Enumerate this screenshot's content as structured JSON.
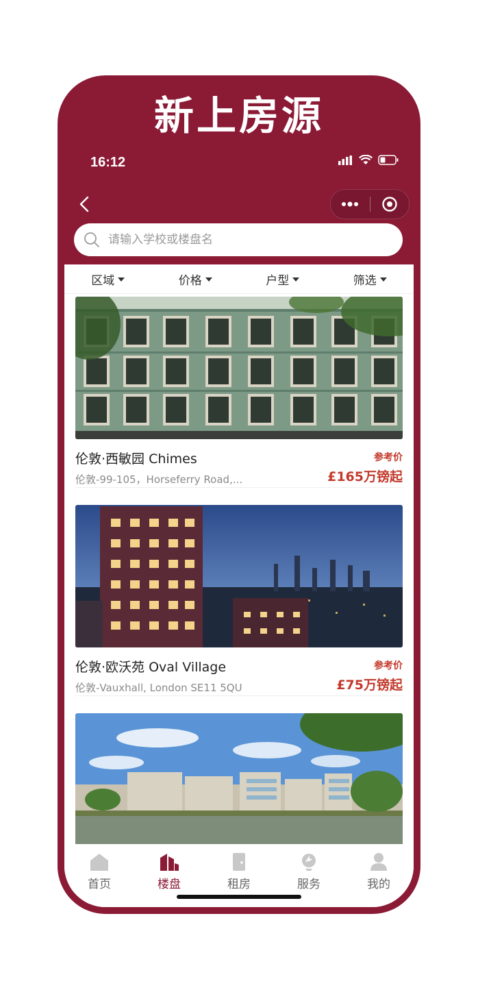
{
  "banner": {
    "headline": "新上房源"
  },
  "status_bar": {
    "time": "16:12"
  },
  "search": {
    "placeholder": "请输入学校或楼盘名"
  },
  "filters": [
    {
      "label": "区域"
    },
    {
      "label": "价格"
    },
    {
      "label": "户型"
    },
    {
      "label": "筛选"
    }
  ],
  "listings": [
    {
      "name": "伦敦·西敏园 Chimes",
      "address": "伦敦-99-105，Horseferry Road,...",
      "price_label": "参考价",
      "price": "£165万镑起"
    },
    {
      "name": "伦敦·欧沃苑 Oval Village",
      "address": "伦敦-Vauxhall, London SE11 5QU",
      "price_label": "参考价",
      "price": "£75万镑起"
    }
  ],
  "tabs": [
    {
      "label": "首页",
      "icon": "home-icon"
    },
    {
      "label": "楼盘",
      "icon": "buildings-icon"
    },
    {
      "label": "租房",
      "icon": "door-icon"
    },
    {
      "label": "服务",
      "icon": "service-icon"
    },
    {
      "label": "我的",
      "icon": "user-icon"
    }
  ],
  "colors": {
    "brand": "#8b1a35",
    "price_red": "#c2392b"
  }
}
